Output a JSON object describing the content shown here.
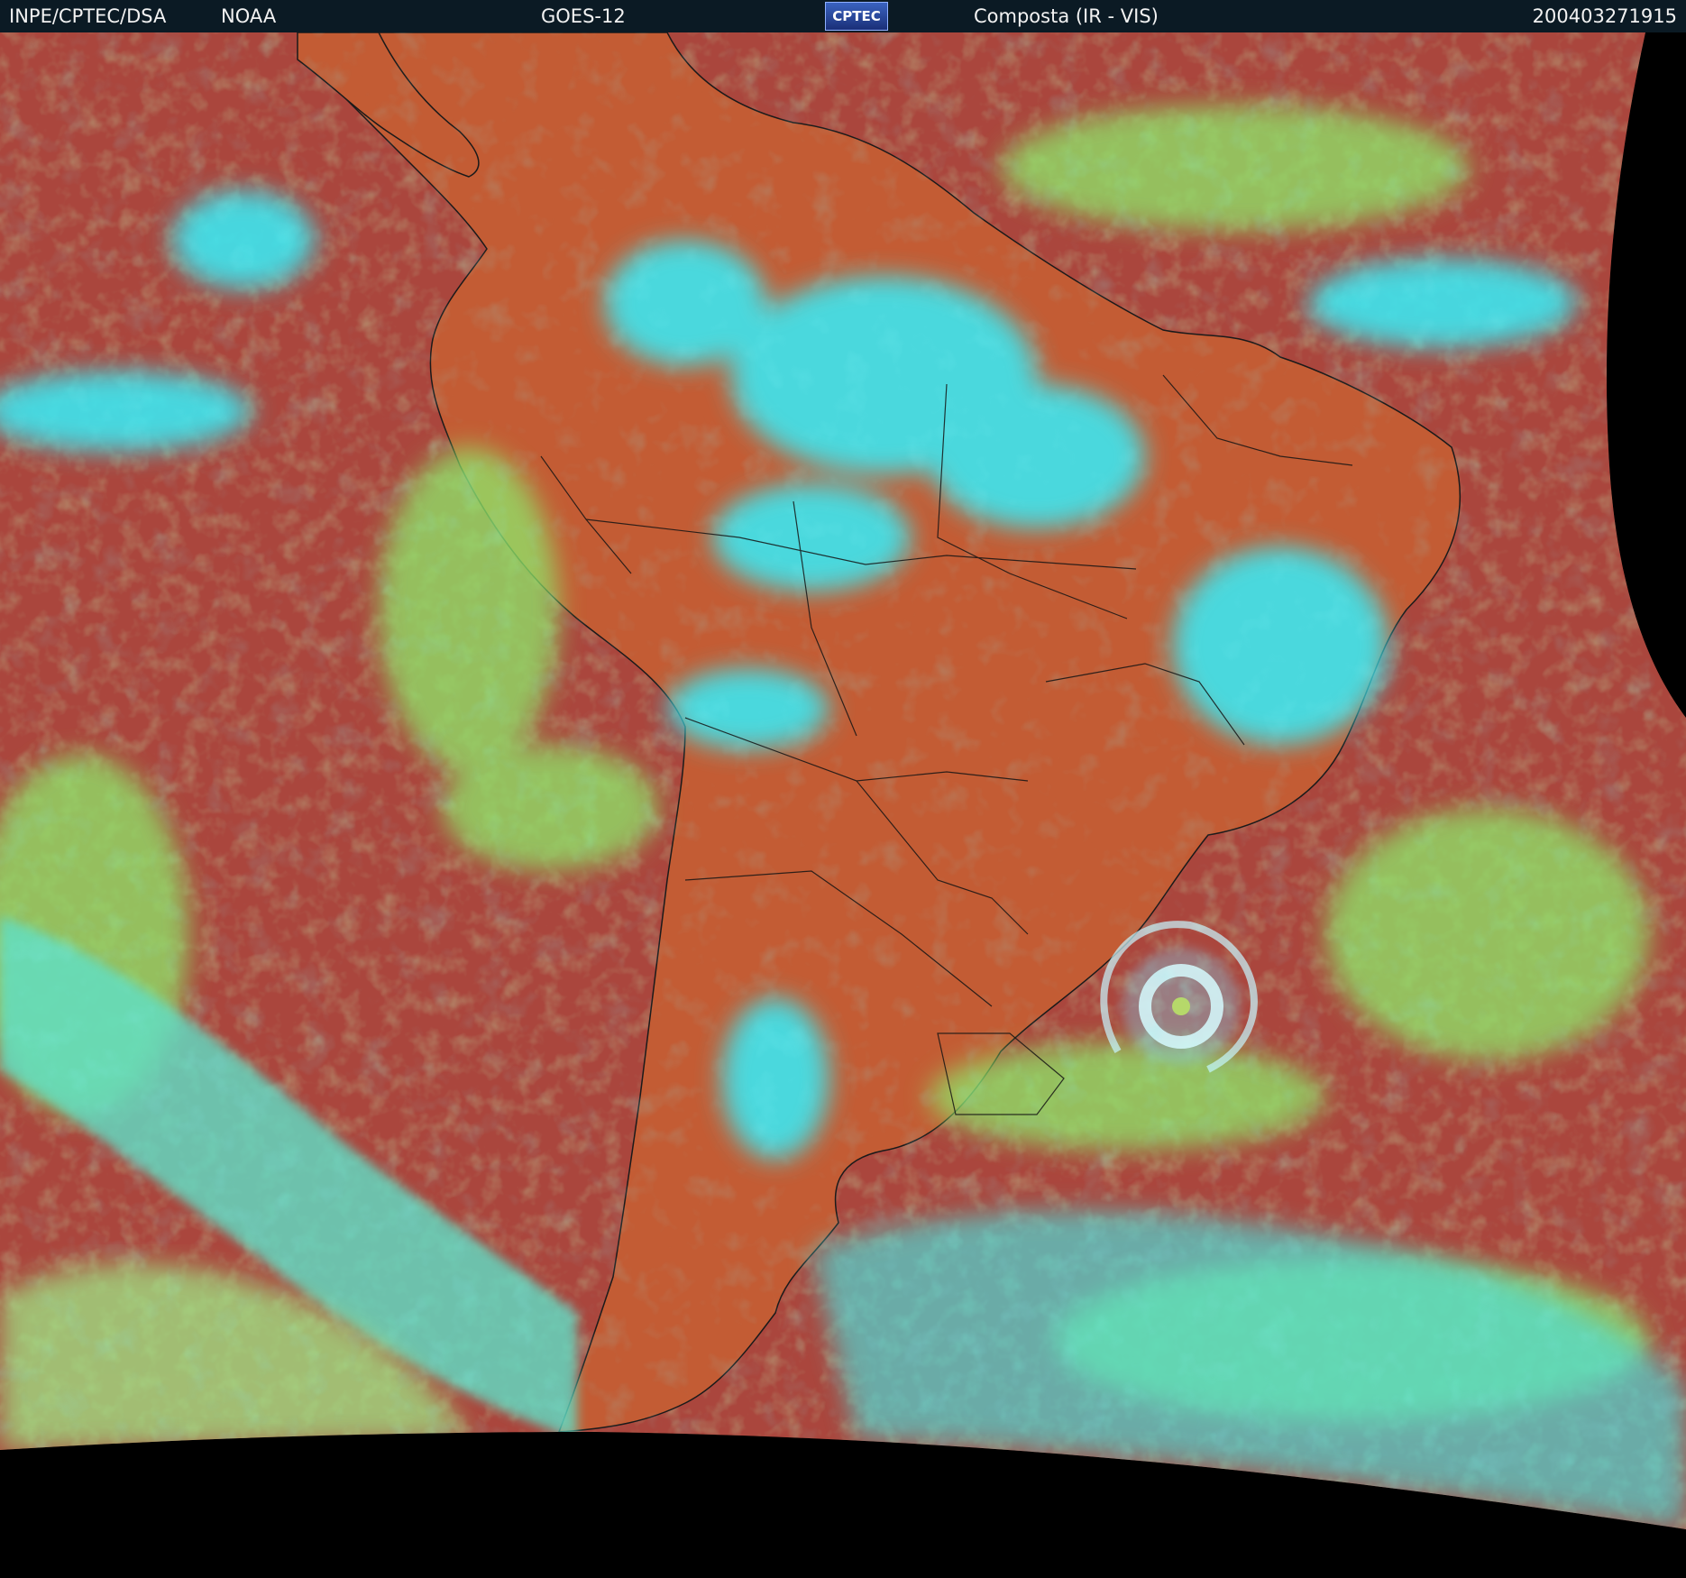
{
  "header": {
    "agency": "INPE/CPTEC/DSA",
    "partner": "NOAA",
    "satellite": "GOES-12",
    "logo_text": "CPTEC",
    "product": "Composta (IR - VIS)",
    "timestamp": "200403271915"
  },
  "colors": {
    "header_background": "#0b1a24",
    "header_text": "#f2f2f2",
    "no_data": "#000000",
    "clear_ocean": "#a8443e",
    "clear_land": "#c9612e",
    "low_cloud": "#8ee86a",
    "high_cloud": "#38e8f0",
    "coastline": "#101010"
  },
  "image": {
    "description": "",
    "features": []
  }
}
